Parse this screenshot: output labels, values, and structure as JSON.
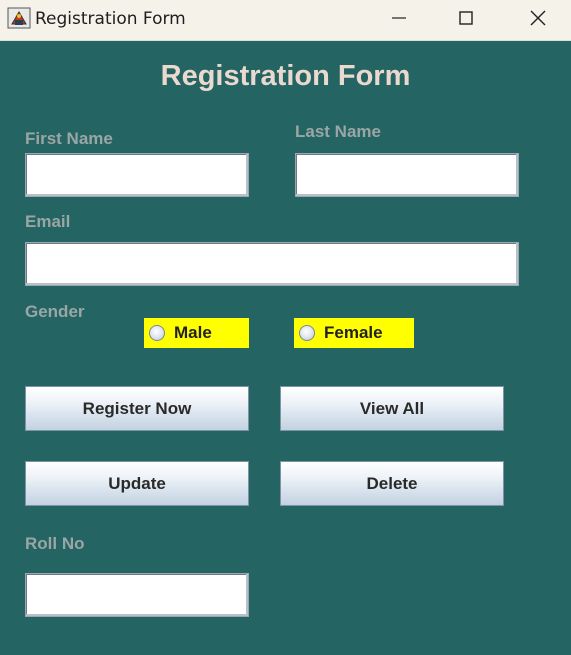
{
  "window": {
    "title": "Registration Form",
    "icon": "java-cup-icon",
    "controls": [
      "minimize",
      "maximize",
      "close"
    ]
  },
  "form": {
    "heading": "Registration Form",
    "first_name_label": "First Name",
    "first_name_value": "",
    "last_name_label": "Last Name",
    "last_name_value": "",
    "email_label": "Email",
    "email_value": "",
    "gender_label": "Gender",
    "gender_options": [
      "Male",
      "Female"
    ],
    "gender_selected": null,
    "roll_no_label": "Roll No",
    "roll_no_value": ""
  },
  "buttons": {
    "register": "Register Now",
    "view_all": "View All",
    "update": "Update",
    "delete": "Delete"
  },
  "colors": {
    "background": "#246462",
    "heading": "#ead9cf",
    "label": "#9aa6a6",
    "radio_background": "#ffff00"
  }
}
